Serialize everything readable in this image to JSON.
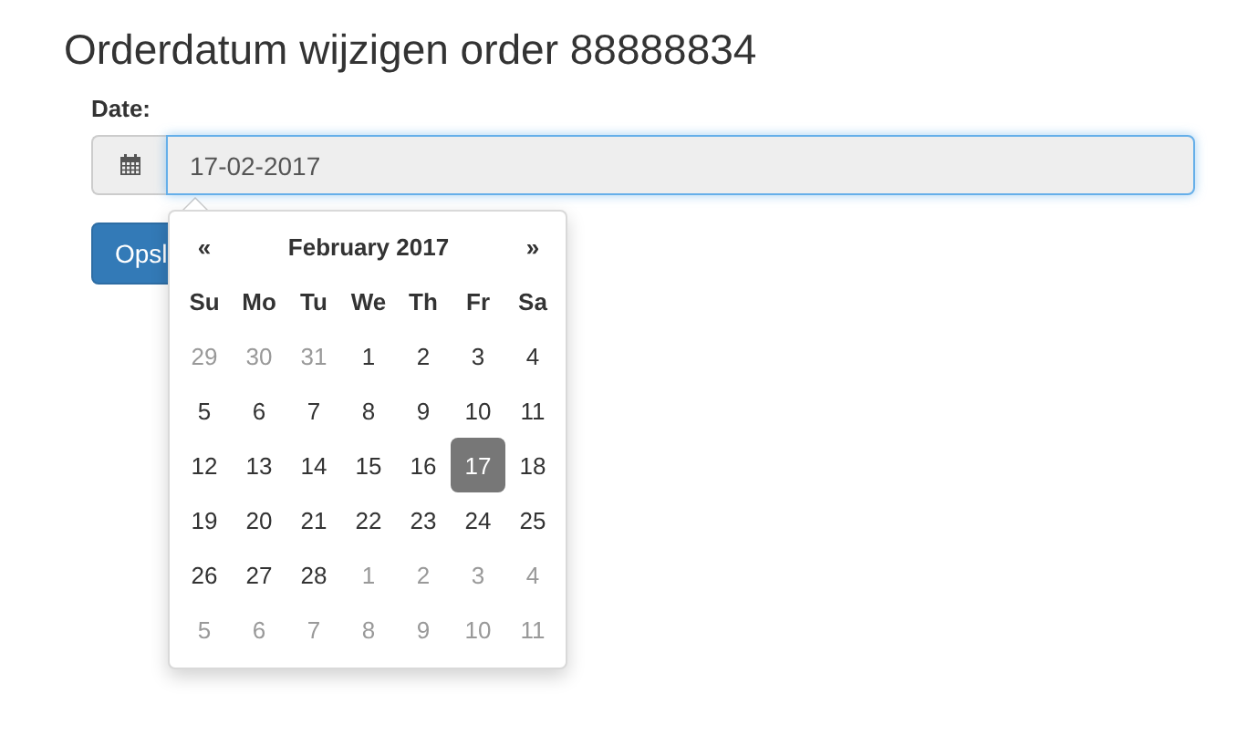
{
  "title": "Orderdatum wijzigen order 88888834",
  "date_field": {
    "label": "Date:",
    "value": "17-02-2017"
  },
  "save_button": {
    "label": "Opsl"
  },
  "calendar": {
    "prev": "«",
    "month": "February 2017",
    "next": "»",
    "weekdays": [
      "Su",
      "Mo",
      "Tu",
      "We",
      "Th",
      "Fr",
      "Sa"
    ],
    "weeks": [
      [
        {
          "day": "29",
          "muted": true,
          "selected": false
        },
        {
          "day": "30",
          "muted": true,
          "selected": false
        },
        {
          "day": "31",
          "muted": true,
          "selected": false
        },
        {
          "day": "1",
          "muted": false,
          "selected": false
        },
        {
          "day": "2",
          "muted": false,
          "selected": false
        },
        {
          "day": "3",
          "muted": false,
          "selected": false
        },
        {
          "day": "4",
          "muted": false,
          "selected": false
        }
      ],
      [
        {
          "day": "5",
          "muted": false,
          "selected": false
        },
        {
          "day": "6",
          "muted": false,
          "selected": false
        },
        {
          "day": "7",
          "muted": false,
          "selected": false
        },
        {
          "day": "8",
          "muted": false,
          "selected": false
        },
        {
          "day": "9",
          "muted": false,
          "selected": false
        },
        {
          "day": "10",
          "muted": false,
          "selected": false
        },
        {
          "day": "11",
          "muted": false,
          "selected": false
        }
      ],
      [
        {
          "day": "12",
          "muted": false,
          "selected": false
        },
        {
          "day": "13",
          "muted": false,
          "selected": false
        },
        {
          "day": "14",
          "muted": false,
          "selected": false
        },
        {
          "day": "15",
          "muted": false,
          "selected": false
        },
        {
          "day": "16",
          "muted": false,
          "selected": false
        },
        {
          "day": "17",
          "muted": false,
          "selected": true
        },
        {
          "day": "18",
          "muted": false,
          "selected": false
        }
      ],
      [
        {
          "day": "19",
          "muted": false,
          "selected": false
        },
        {
          "day": "20",
          "muted": false,
          "selected": false
        },
        {
          "day": "21",
          "muted": false,
          "selected": false
        },
        {
          "day": "22",
          "muted": false,
          "selected": false
        },
        {
          "day": "23",
          "muted": false,
          "selected": false
        },
        {
          "day": "24",
          "muted": false,
          "selected": false
        },
        {
          "day": "25",
          "muted": false,
          "selected": false
        }
      ],
      [
        {
          "day": "26",
          "muted": false,
          "selected": false
        },
        {
          "day": "27",
          "muted": false,
          "selected": false
        },
        {
          "day": "28",
          "muted": false,
          "selected": false
        },
        {
          "day": "1",
          "muted": true,
          "selected": false
        },
        {
          "day": "2",
          "muted": true,
          "selected": false
        },
        {
          "day": "3",
          "muted": true,
          "selected": false
        },
        {
          "day": "4",
          "muted": true,
          "selected": false
        }
      ],
      [
        {
          "day": "5",
          "muted": true,
          "selected": false
        },
        {
          "day": "6",
          "muted": true,
          "selected": false
        },
        {
          "day": "7",
          "muted": true,
          "selected": false
        },
        {
          "day": "8",
          "muted": true,
          "selected": false
        },
        {
          "day": "9",
          "muted": true,
          "selected": false
        },
        {
          "day": "10",
          "muted": true,
          "selected": false
        },
        {
          "day": "11",
          "muted": true,
          "selected": false
        }
      ]
    ]
  }
}
